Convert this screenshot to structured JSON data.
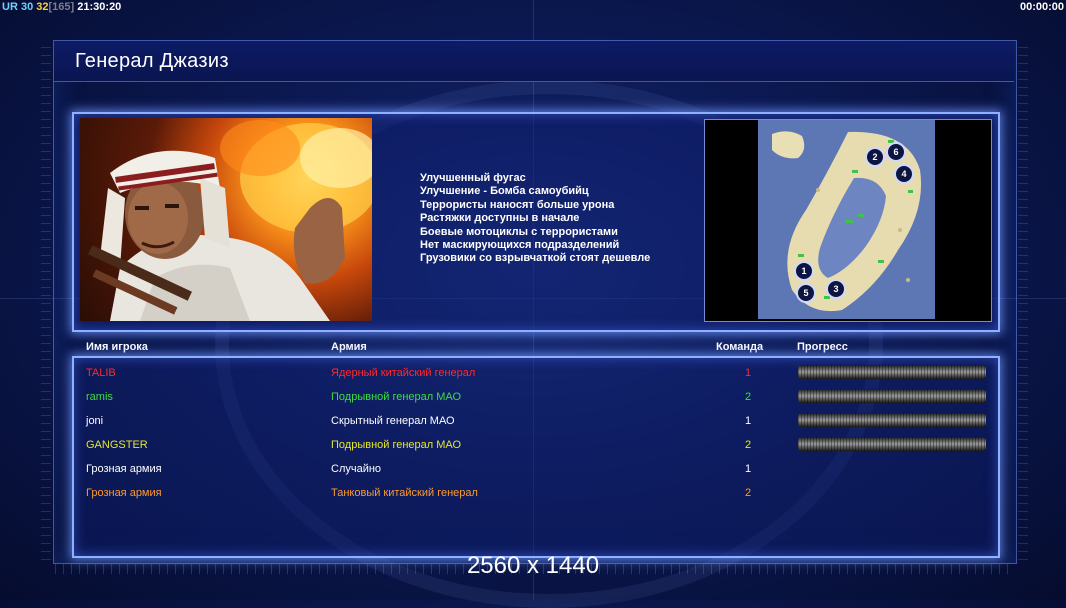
{
  "hud": {
    "ur": "UR",
    "left_num": "30",
    "right_num": "32",
    "bracket": "[165]",
    "clock": "21:30:20",
    "timer": "00:00:00"
  },
  "general": {
    "title": "Генерал Джазиз"
  },
  "features": [
    "Улучшенный фугас",
    "Улучшение - Бомба самоубийц",
    "Террористы наносят больше урона",
    "Растяжки доступны в начале",
    "Боевые мотоциклы с террористами",
    "Нет маскирующихся подразделений",
    "Грузовики со взрывчаткой стоят дешевле"
  ],
  "minimap": {
    "slots": [
      "1",
      "2",
      "3",
      "4",
      "5",
      "6"
    ]
  },
  "table": {
    "headers": {
      "name": "Имя игрока",
      "army": "Армия",
      "team": "Команда",
      "progress": "Прогресс"
    },
    "rows": [
      {
        "name": "TALIB",
        "army": "Ядерный китайский генерал",
        "team": "1",
        "color": "#ff2a2a",
        "progress": 1.0
      },
      {
        "name": "ramis",
        "army": "Подрывной генерал МАО",
        "team": "2",
        "color": "#3fdc3f",
        "progress": 1.0
      },
      {
        "name": "joni",
        "army": "Скрытный генерал МАО",
        "team": "1",
        "color": "#ffffff",
        "progress": 1.0
      },
      {
        "name": "GANGSTER",
        "army": "Подрывной генерал МАО",
        "team": "2",
        "color": "#e6e62a",
        "progress": 1.0
      },
      {
        "name": "Грозная армия",
        "army": "Случайно",
        "team": "1",
        "color": "#ffffff",
        "progress": null
      },
      {
        "name": "Грозная армия",
        "army": "Танковый китайский генерал",
        "team": "2",
        "color": "#ff9a2a",
        "progress": null
      }
    ]
  },
  "resolution": "2560 x 1440"
}
